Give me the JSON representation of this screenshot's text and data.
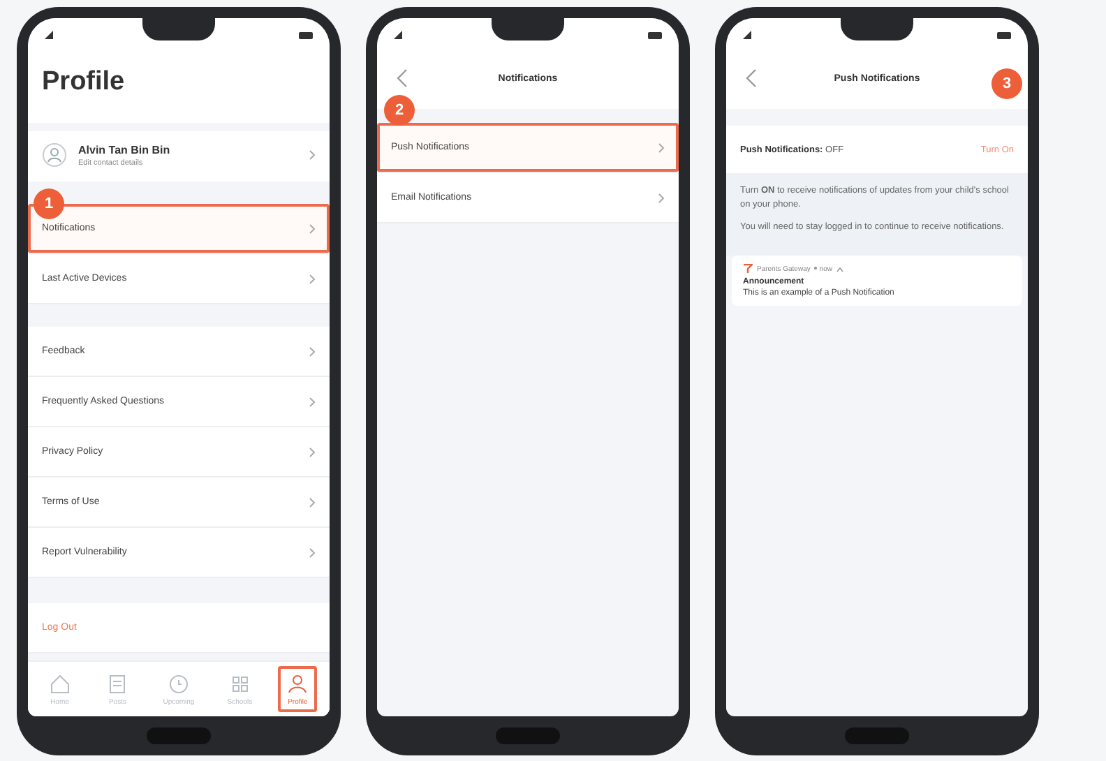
{
  "phones": [
    {
      "kind": "profile",
      "step": "1",
      "title": "Profile",
      "user": {
        "name": "Alvin Tan Bin Bin",
        "subtitle": "Edit contact details"
      },
      "sections": [
        [
          {
            "label": "Notifications",
            "highlighted": true
          },
          {
            "label": "Last Active Devices",
            "highlighted": false
          }
        ],
        [
          {
            "label": "Feedback",
            "highlighted": false
          },
          {
            "label": "Frequently Asked Questions",
            "highlighted": false
          },
          {
            "label": "Privacy Policy",
            "highlighted": false
          },
          {
            "label": "Terms of Use",
            "highlighted": false
          },
          {
            "label": "Report Vulnerability",
            "highlighted": false
          }
        ]
      ],
      "logout": "Log Out",
      "tabs": [
        {
          "label": "Home",
          "selected": false
        },
        {
          "label": "Posts",
          "selected": false
        },
        {
          "label": "Upcoming",
          "selected": false
        },
        {
          "label": "Schools",
          "selected": false
        },
        {
          "label": "Profile",
          "selected": true
        }
      ]
    },
    {
      "kind": "list",
      "step": "2",
      "title": "Notifications",
      "rows": [
        {
          "label": "Push Notifications",
          "highlighted": true
        },
        {
          "label": "Email Notifications",
          "highlighted": false
        }
      ]
    },
    {
      "kind": "detail",
      "step": "3",
      "title": "Push Notifications",
      "setting": {
        "label": "Push Notifications:",
        "value": "OFF",
        "action": "Turn On"
      },
      "paragraphs": [
        "Turn **ON** to receive notifications of updates from your child's school on your phone.",
        "You will need to stay logged in to continue to receive notifications."
      ],
      "preview": {
        "app": "Parents Gateway",
        "time": "now",
        "heading": "Announcement",
        "body": "This is an example of a Push Notification"
      }
    }
  ]
}
